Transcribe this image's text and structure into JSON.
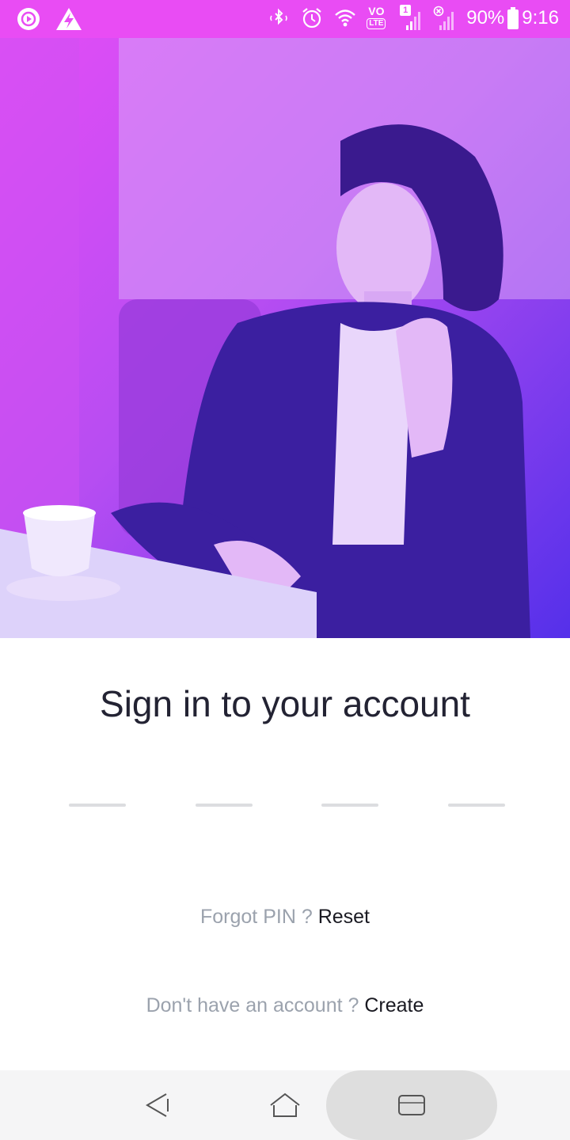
{
  "status_bar": {
    "battery_percent": "90%",
    "time": "9:16",
    "sim_badge": "1",
    "volte_label": "VO",
    "lte_label": "LTE",
    "icons": [
      "play-circle-icon",
      "lightning-triangle-icon",
      "bluetooth-icon",
      "alarm-icon",
      "wifi-icon",
      "volte-icon",
      "signal-icon",
      "signal-disabled-icon",
      "battery-icon"
    ],
    "background_color": "#e94cf4"
  },
  "hero": {
    "gradient_colors": [
      "#e24cf5",
      "#4a2be6"
    ]
  },
  "signin": {
    "title": "Sign in to your account",
    "pin_length": 4
  },
  "forgot": {
    "prompt": "Forgot PIN ?",
    "action": "Reset"
  },
  "signup": {
    "prompt": "Don't have an account ?",
    "action": "Create"
  },
  "nav": {
    "icons": [
      "back-icon",
      "home-icon",
      "recents-icon"
    ]
  },
  "colors": {
    "title": "#232333",
    "muted": "#9ba2ad",
    "link": "#1a1a22",
    "pin_slot": "#dcdde0"
  }
}
